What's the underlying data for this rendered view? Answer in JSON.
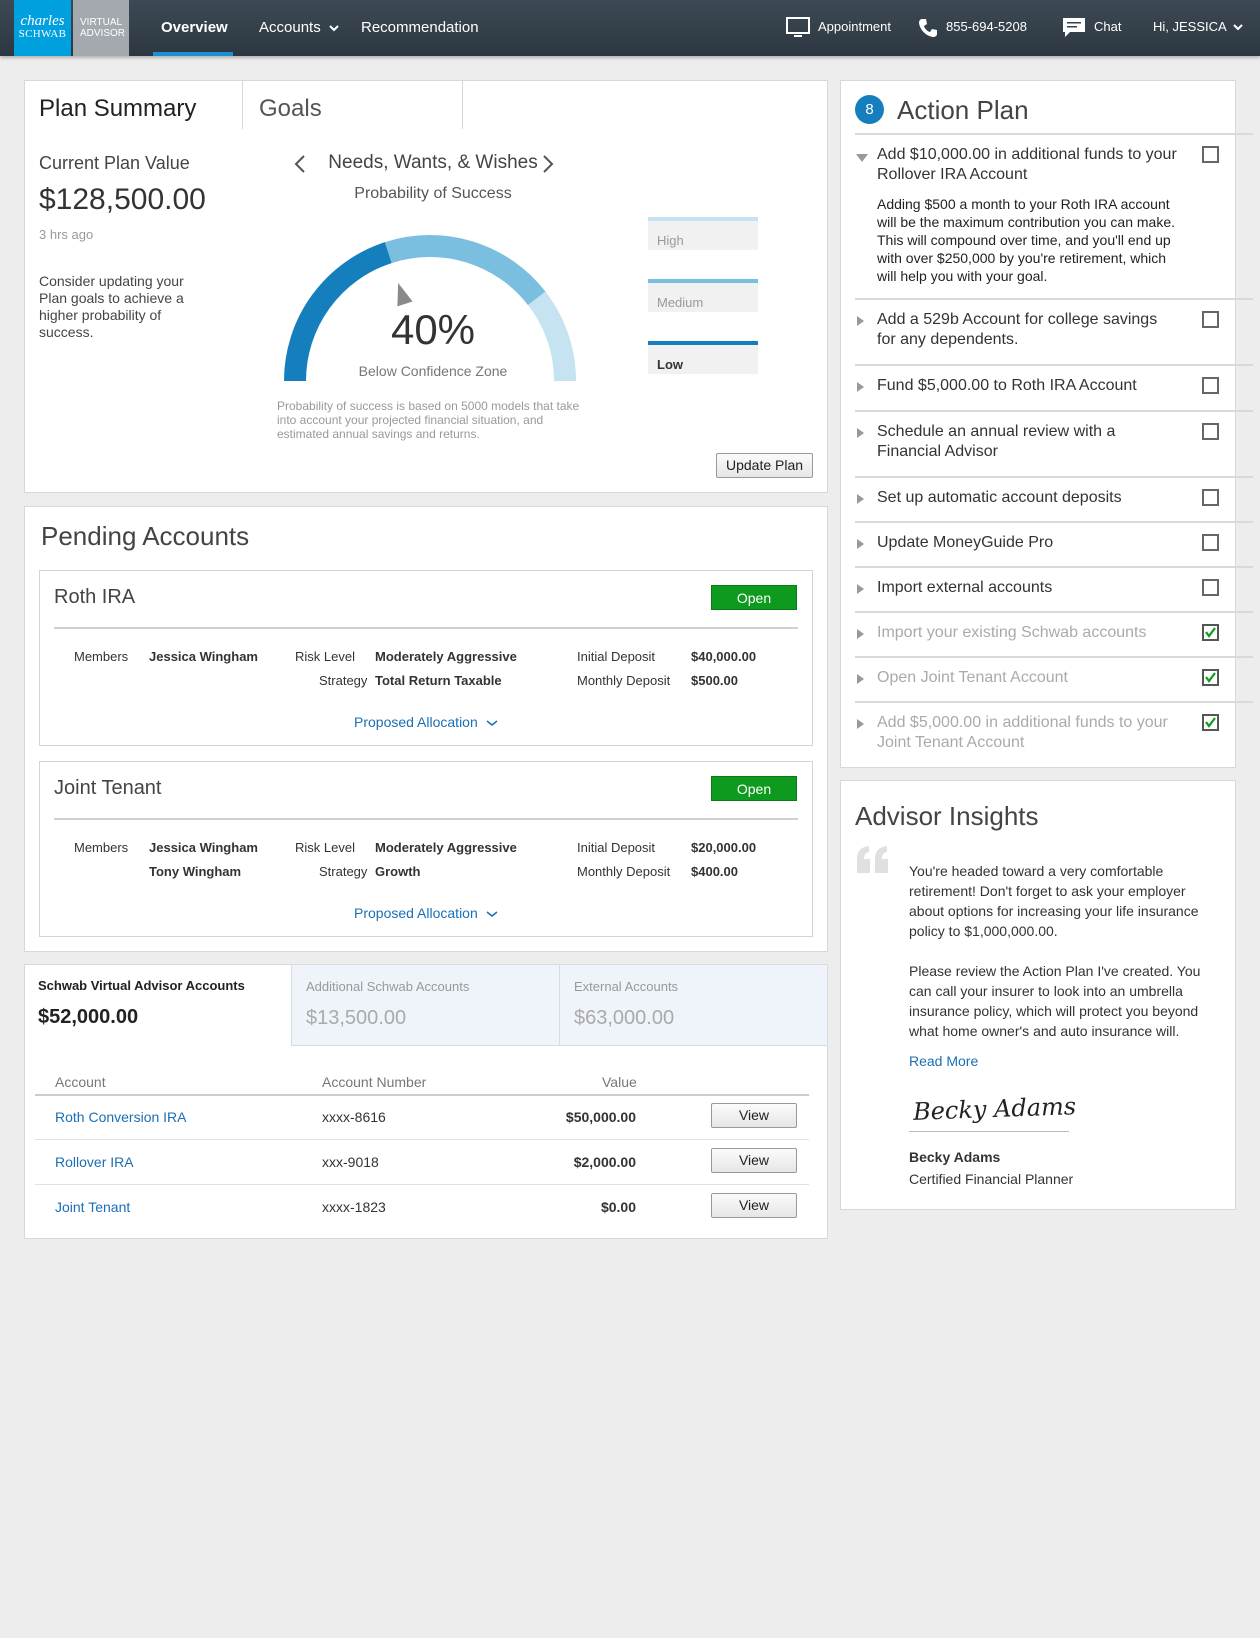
{
  "nav": {
    "logo_line1": "charles",
    "logo_line2": "SCHWAB",
    "logo_sub1": "VIRTUAL",
    "logo_sub2": "ADVISOR",
    "overview": "Overview",
    "accounts": "Accounts",
    "recommendation": "Recommendation",
    "appointment": "Appointment",
    "phone": "855-694-5208",
    "chat": "Chat",
    "greeting": "Hi, JESSICA"
  },
  "plan": {
    "tab_summary": "Plan Summary",
    "tab_goals": "Goals",
    "current_value_label": "Current Plan Value",
    "current_value": "$128,500.00",
    "updated": "3 hrs ago",
    "advice": "Consider updating your Plan goals to achieve a higher probability of success.",
    "goal_name": "Needs, Wants, & Wishes",
    "probability_label": "Probability of Success",
    "probability": "40%",
    "probability_value": 0.4,
    "zone_label": "Below Confidence Zone",
    "disclaimer": "Probability of success is based on 5000 models that take into account your projected financial situation, and estimated annual savings and returns.",
    "levels": [
      "High",
      "Medium",
      "Low"
    ],
    "update_button": "Update Plan"
  },
  "pending": {
    "title": "Pending Accounts",
    "cards": [
      {
        "name": "Roth IRA",
        "open_button": "Open",
        "members_label": "Members",
        "member1": "Jessica Wingham",
        "member2": "",
        "risk_label": "Risk Level",
        "risk": "Moderately Aggressive",
        "strategy_label": "Strategy",
        "strategy": "Total Return Taxable",
        "initial_label": "Initial Deposit",
        "initial": "$40,000.00",
        "monthly_label": "Monthly Deposit",
        "monthly": "$500.00",
        "allocation_link": "Proposed Allocation"
      },
      {
        "name": "Joint Tenant",
        "open_button": "Open",
        "members_label": "Members",
        "member1": "Jessica Wingham",
        "member2": "Tony Wingham",
        "risk_label": "Risk Level",
        "risk": "Moderately Aggressive",
        "strategy_label": "Strategy",
        "strategy": "Growth",
        "initial_label": "Initial Deposit",
        "initial": "$20,000.00",
        "monthly_label": "Monthly Deposit",
        "monthly": "$400.00",
        "allocation_link": "Proposed Allocation"
      }
    ]
  },
  "accounts": {
    "tabs": [
      {
        "label": "Schwab Virtual Advisor Accounts",
        "value": "$52,000.00"
      },
      {
        "label": "Additional Schwab Accounts",
        "value": "$13,500.00"
      },
      {
        "label": "External Accounts",
        "value": "$63,000.00"
      }
    ],
    "columns": [
      "Account",
      "Account Number",
      "Value"
    ],
    "rows": [
      {
        "account": "Roth Conversion IRA",
        "number": "xxxx-8616",
        "value": "$50,000.00",
        "action": "View"
      },
      {
        "account": "Rollover IRA",
        "number": "xxx-9018",
        "value": "$2,000.00",
        "action": "View"
      },
      {
        "account": "Joint Tenant",
        "number": "xxxx-1823",
        "value": "$0.00",
        "action": "View"
      }
    ]
  },
  "action_plan": {
    "count": "8",
    "title": "Action Plan",
    "items": [
      {
        "text": "Add $10,000.00 in additional funds to your Rollover IRA Account",
        "checked": false,
        "detail": "Adding $500 a month to your Roth IRA account will be the maximum contribution you can make. This will compound over time, and you'll end up with over $250,000 by you're retirement, which will help you with your goal."
      },
      {
        "text": "Add a 529b Account for college savings for any dependents.",
        "checked": false
      },
      {
        "text": "Fund $5,000.00 to Roth IRA Account",
        "checked": false
      },
      {
        "text": "Schedule an annual review with a Financial Advisor",
        "checked": false
      },
      {
        "text": "Set up automatic account deposits",
        "checked": false
      },
      {
        "text": "Update MoneyGuide Pro",
        "checked": false
      },
      {
        "text": "Import external accounts",
        "checked": false
      },
      {
        "text": "Import your existing Schwab accounts",
        "checked": true
      },
      {
        "text": "Open Joint Tenant Account",
        "checked": true
      },
      {
        "text": "Add $5,000.00 in additional funds to your Joint Tenant Account",
        "checked": true
      }
    ]
  },
  "insights": {
    "title": "Advisor Insights",
    "paragraph1": "You're headed toward a very comfortable retirement! Don't forget to ask your employer about options for increasing your life insurance policy to $1,000,000.00.",
    "paragraph2": "Please review the Action Plan I've created. You can call your insurer to look into an umbrella insurance policy, which will protect you beyond what home owner's and auto insurance will.",
    "read_more": "Read More",
    "signature": "Becky Adams",
    "advisor_name": "Becky Adams",
    "advisor_title": "Certified Financial Planner"
  },
  "colors": {
    "nav_bg": "#333f49",
    "brand_blue": "#00a0df",
    "gauge_dark": "#157fbd",
    "gauge_mid": "#7bbfe0",
    "gauge_light": "#c6e3f1",
    "open_green": "#0e9a1e",
    "link": "#1a6fb5"
  }
}
